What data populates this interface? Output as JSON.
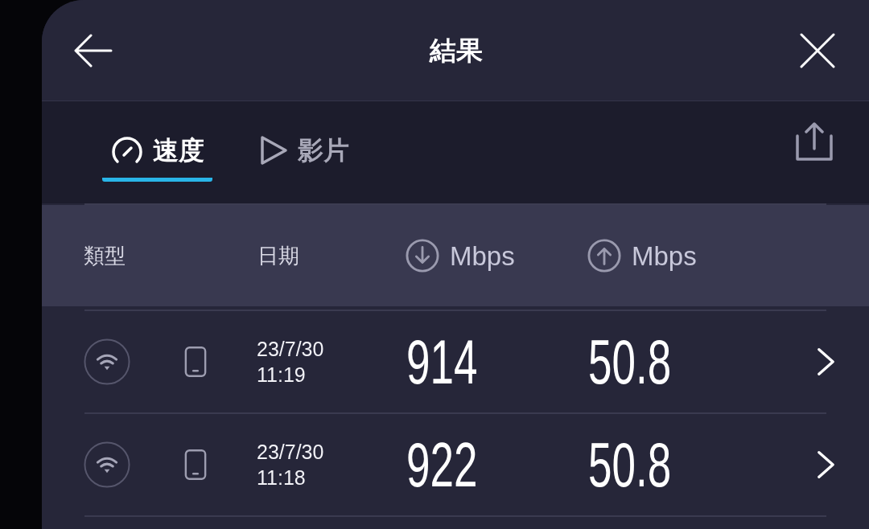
{
  "header": {
    "title": "結果"
  },
  "tabs": [
    {
      "label": "速度",
      "kind": "speed",
      "selected": true
    },
    {
      "label": "影片",
      "kind": "video",
      "selected": false
    }
  ],
  "table": {
    "columns": [
      {
        "label": "類型",
        "kind": "text"
      },
      {
        "label": "日期",
        "kind": "text"
      },
      {
        "label": "Mbps",
        "kind": "download"
      },
      {
        "label": "Mbps",
        "kind": "upload"
      }
    ],
    "rows": [
      {
        "date": "23/7/30",
        "time": "11:19",
        "download": "914",
        "upload": "50.8"
      },
      {
        "date": "23/7/30",
        "time": "11:18",
        "download": "922",
        "upload": "50.8"
      }
    ]
  }
}
